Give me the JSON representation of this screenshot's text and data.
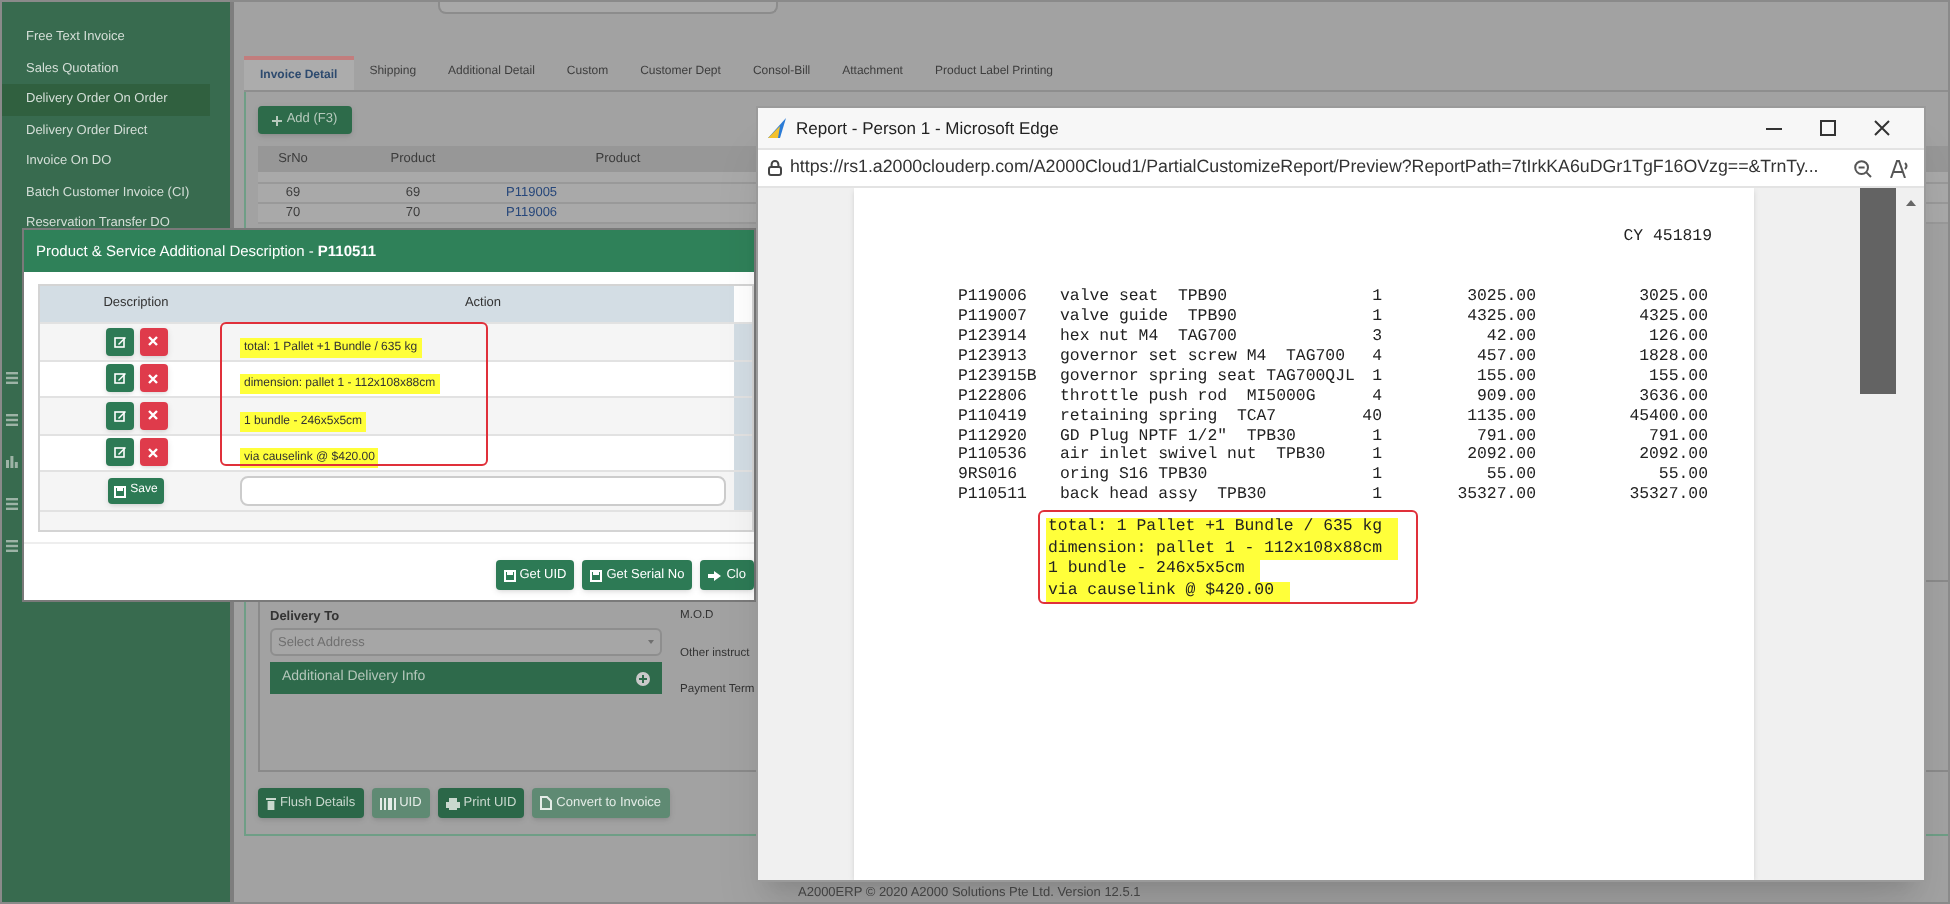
{
  "sidebar": {
    "items": [
      {
        "label": "Free Text Invoice",
        "selected": false
      },
      {
        "label": "Sales Quotation",
        "selected": false
      },
      {
        "label": "Delivery Order On Order",
        "selected": true
      },
      {
        "label": "Delivery Order Direct",
        "selected": false
      },
      {
        "label": "Invoice On DO",
        "selected": false
      },
      {
        "label": "Batch Customer Invoice (CI)",
        "selected": false
      },
      {
        "label": "Reservation Transfer DO",
        "selected": false
      }
    ]
  },
  "main": {
    "tabs": [
      {
        "label": "Invoice Detail",
        "selected": true
      },
      {
        "label": "Shipping",
        "selected": false
      },
      {
        "label": "Additional Detail",
        "selected": false
      },
      {
        "label": "Custom",
        "selected": false
      },
      {
        "label": "Customer Dept",
        "selected": false
      },
      {
        "label": "Consol-Bill",
        "selected": false
      },
      {
        "label": "Attachment",
        "selected": false
      },
      {
        "label": "Product Label Printing",
        "selected": false
      }
    ],
    "add_button": "Add (F3)",
    "table": {
      "columns": [
        "SrNo",
        "Product",
        "Product"
      ],
      "rows": [
        [
          "69",
          "69",
          "P119005"
        ],
        [
          "70",
          "70",
          "P119006"
        ]
      ]
    },
    "delivery_to": {
      "label": "Delivery To",
      "placeholder": "Select Address"
    },
    "additional_delivery_info": "Additional Delivery Info",
    "side_labels": [
      "M.O.D",
      "Other instruct",
      "Payment Term"
    ],
    "buttons": [
      {
        "label": "Flush Details",
        "kind": "trash",
        "disabled": false
      },
      {
        "label": "UID",
        "kind": "barcode",
        "disabled": true
      },
      {
        "label": "Print UID",
        "kind": "print",
        "disabled": false
      },
      {
        "label": "Convert to Invoice",
        "kind": "file",
        "disabled": true
      }
    ],
    "footer": "A2000ERP © 2020 A2000 Solutions Pte Ltd. Version 12.5.1"
  },
  "modal": {
    "title": "Product & Service Additional Description - **P110511**",
    "columns": [
      "Description",
      "Action"
    ],
    "rows": [
      {
        "text": "total: 1 Pallet +1 Bundle / 635 kg"
      },
      {
        "text": "dimension: pallet 1 - 112x108x88cm"
      },
      {
        "text": "1 bundle - 246x5x5cm"
      },
      {
        "text": "via causelink @ $420.00"
      }
    ],
    "save_button": "Save",
    "buttons": [
      {
        "label": "Get UID",
        "kind": "save"
      },
      {
        "label": "Get Serial No",
        "kind": "save"
      },
      {
        "label": "Clo",
        "kind": "exit"
      }
    ]
  },
  "browser": {
    "title": "Report - Person 1 - Microsoft Edge",
    "url": "https://rs1.a2000clouderp.com/A2000Cloud1/PartialCustomizeReport/Preview?ReportPath=7tIrkKA6uDGr1TgF16OVzg==&TrnTy...",
    "report": {
      "header": "CY 451819",
      "lines": [
        [
          "P119006",
          "valve seat  TPB90",
          "1",
          "3025.00",
          "3025.00"
        ],
        [
          "P119007",
          "valve guide  TPB90",
          "1",
          "4325.00",
          "4325.00"
        ],
        [
          "P123914",
          "hex nut M4  TAG700",
          "3",
          "42.00",
          "126.00"
        ],
        [
          "P123913",
          "governor set screw M4  TAG700",
          "4",
          "457.00",
          "1828.00"
        ],
        [
          "P123915B",
          "governor spring seat TAG700QJL",
          "1",
          "155.00",
          "155.00"
        ],
        [
          "P122806",
          "throttle push rod  MI5000G",
          "4",
          "909.00",
          "3636.00"
        ],
        [
          "P110419",
          "retaining spring  TCA7",
          "40",
          "1135.00",
          "45400.00"
        ],
        [
          "P112920",
          "GD Plug NPTF 1/2\"  TPB30",
          "1",
          "791.00",
          "791.00"
        ],
        [
          "P110536",
          "air inlet swivel nut  TPB30",
          "1",
          "2092.00",
          "2092.00"
        ],
        [
          "9RS016",
          "oring S16 TPB30",
          "1",
          "55.00",
          "55.00"
        ],
        [
          "P110511",
          "back head assy  TPB30",
          "1",
          "35327.00",
          "35327.00"
        ]
      ],
      "notes": [
        "total: 1 Pallet +1 Bundle / 635 kg",
        "dimension: pallet 1 - 112x108x88cm",
        "1 bundle - 246x5x5cm",
        "via causelink @ $420.00"
      ]
    }
  }
}
